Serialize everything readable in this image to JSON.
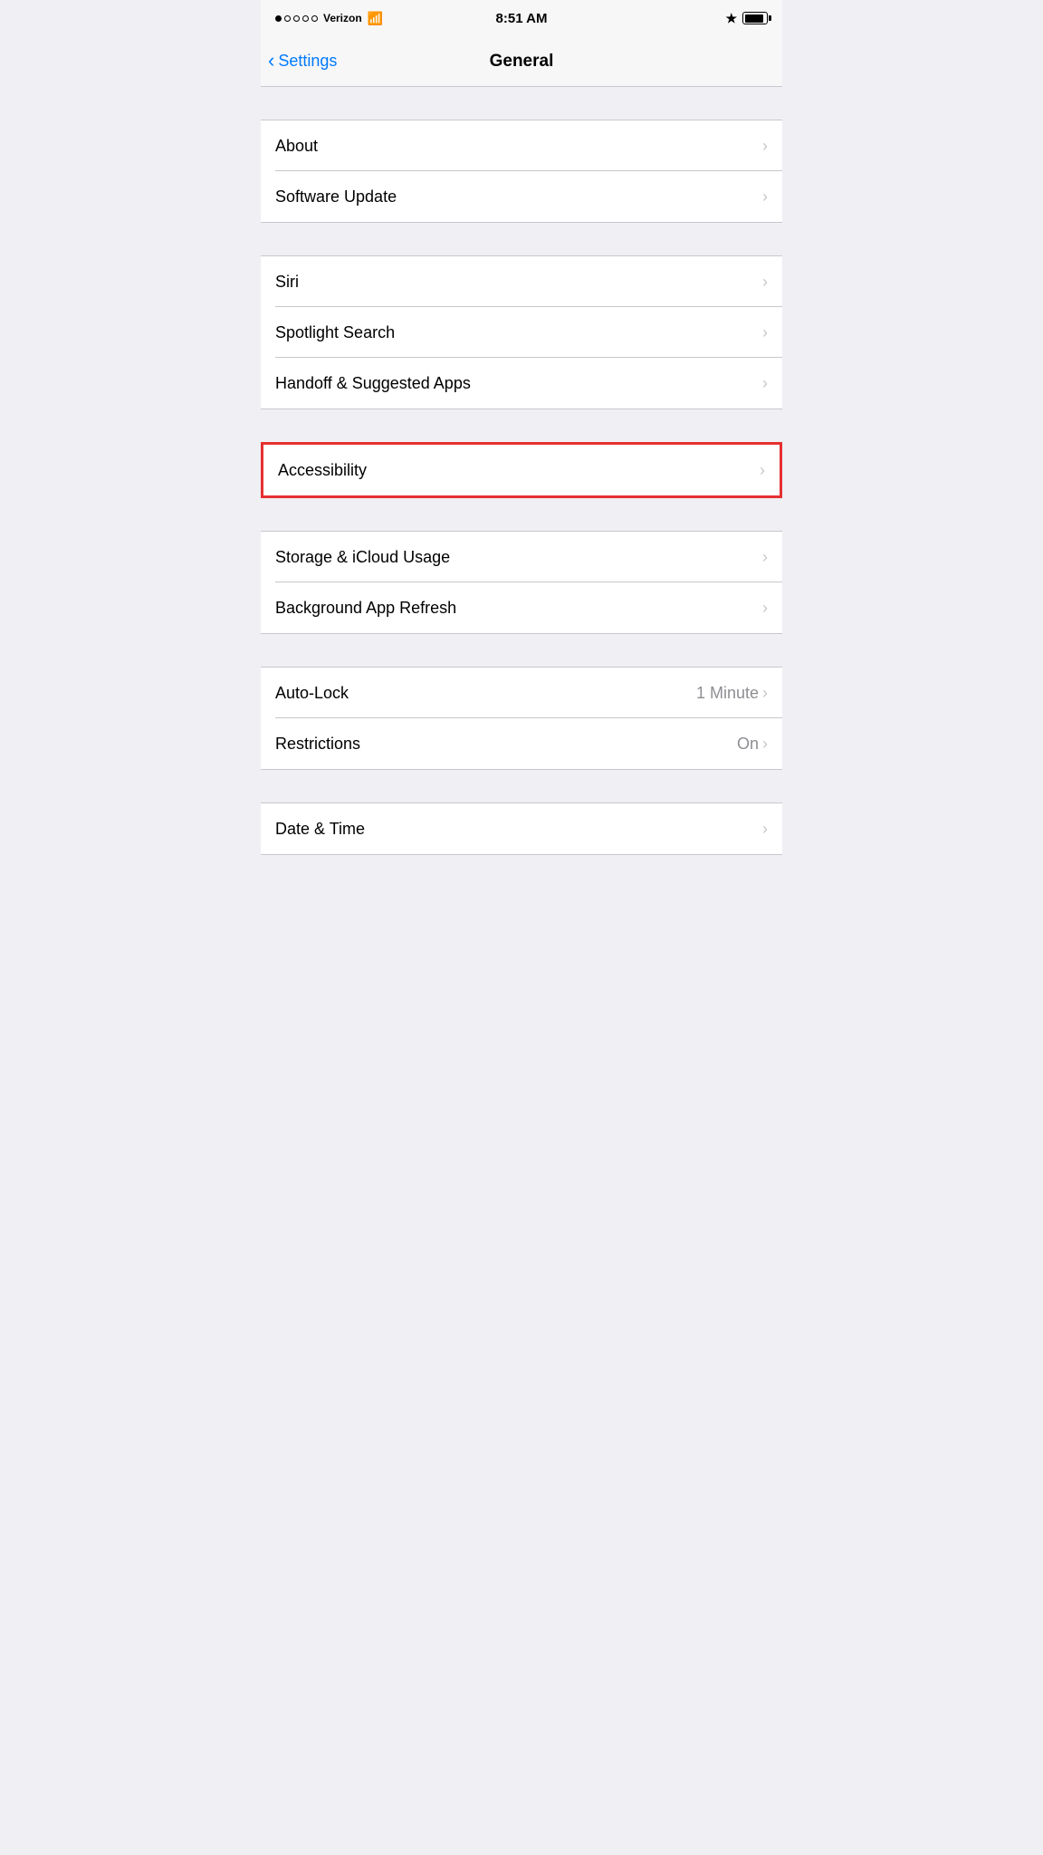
{
  "statusBar": {
    "carrier": "Verizon",
    "time": "8:51 AM"
  },
  "navBar": {
    "backLabel": "Settings",
    "title": "General"
  },
  "sections": [
    {
      "id": "section1",
      "items": [
        {
          "id": "about",
          "label": "About",
          "value": "",
          "chevron": true
        },
        {
          "id": "software-update",
          "label": "Software Update",
          "value": "",
          "chevron": true
        }
      ]
    },
    {
      "id": "section2",
      "items": [
        {
          "id": "siri",
          "label": "Siri",
          "value": "",
          "chevron": true
        },
        {
          "id": "spotlight-search",
          "label": "Spotlight Search",
          "value": "",
          "chevron": true
        },
        {
          "id": "handoff-suggested-apps",
          "label": "Handoff & Suggested Apps",
          "value": "",
          "chevron": true
        }
      ]
    },
    {
      "id": "section3-accessibility",
      "highlighted": true,
      "items": [
        {
          "id": "accessibility",
          "label": "Accessibility",
          "value": "",
          "chevron": true
        }
      ]
    },
    {
      "id": "section4",
      "items": [
        {
          "id": "storage-icloud",
          "label": "Storage & iCloud Usage",
          "value": "",
          "chevron": true
        },
        {
          "id": "background-app-refresh",
          "label": "Background App Refresh",
          "value": "",
          "chevron": true
        }
      ]
    },
    {
      "id": "section5",
      "items": [
        {
          "id": "auto-lock",
          "label": "Auto-Lock",
          "value": "1 Minute",
          "chevron": true
        },
        {
          "id": "restrictions",
          "label": "Restrictions",
          "value": "On",
          "chevron": true
        }
      ]
    },
    {
      "id": "section6",
      "items": [
        {
          "id": "date-time",
          "label": "Date & Time",
          "value": "",
          "chevron": true
        }
      ]
    }
  ]
}
